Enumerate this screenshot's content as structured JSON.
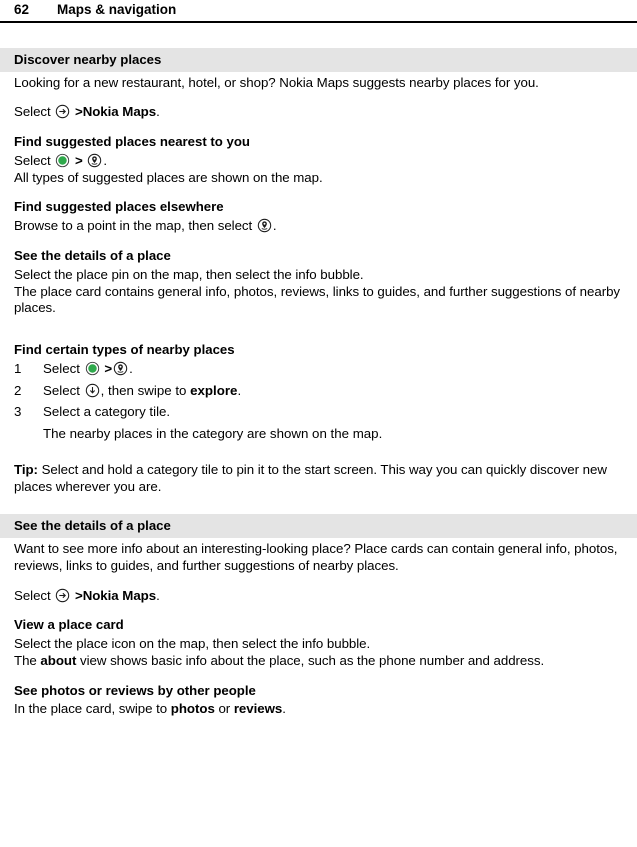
{
  "header": {
    "page_number": "62",
    "chapter": "Maps & navigation"
  },
  "icons": {
    "arrow_right_circle": "arrow-right-circle-icon",
    "green_dot_circle": "green-dot-circle-icon",
    "place_pin_circle": "place-pin-circle-icon",
    "arrow_down_circle": "arrow-down-circle-icon",
    "green_color": "#2FA94C"
  },
  "sections": [
    {
      "bar_title": "Discover nearby places",
      "intro": "Looking for a new restaurant, hotel, or shop? Nokia Maps suggests nearby places for you.",
      "select_prefix": "Select",
      "select_gt": ">",
      "select_target": "Nokia Maps",
      "select_suffix": ".",
      "blocks": [
        {
          "heading": "Find suggested places nearest to you",
          "line_prefix": "Select",
          "line_gt": ">",
          "line_suffix": ".",
          "note": "All types of suggested places are shown on the map."
        },
        {
          "heading": "Find suggested places elsewhere",
          "line_prefix": "Browse to a point in the map, then select",
          "line_suffix": "."
        },
        {
          "heading": "See the details of a place",
          "line1": "Select the place pin on the map, then select the info bubble.",
          "line2": "The place card contains general info, photos, reviews, links to guides, and further suggestions of nearby places."
        }
      ],
      "procedure": {
        "heading": "Find certain types of nearby places",
        "steps": [
          {
            "num": "1",
            "prefix": "Select",
            "gt": ">",
            "suffix": "."
          },
          {
            "num": "2",
            "prefix": "Select",
            "mid": ", then swipe to",
            "bold": "explore",
            "suffix": "."
          },
          {
            "num": "3",
            "prefix": "Select a category tile.",
            "continuation": "The nearby places in the category are shown on the map."
          }
        ]
      },
      "tip": {
        "label": "Tip:",
        "text": " Select and hold a category tile to pin it to the start screen. This way you can quickly discover new places wherever you are."
      }
    },
    {
      "bar_title": "See the details of a place",
      "intro": "Want to see more info about an interesting-looking place? Place cards can contain general info, photos, reviews, links to guides, and further suggestions of nearby places.",
      "select_prefix": "Select",
      "select_gt": ">",
      "select_target": "Nokia Maps",
      "select_suffix": ".",
      "blocks": [
        {
          "heading": "View a place card",
          "line1": "Select the place icon on the map, then select the info bubble.",
          "line2_pre": "The ",
          "line2_bold": "about",
          "line2_post": " view shows basic info about the place, such as the phone number and address."
        },
        {
          "heading": "See photos or reviews by other people",
          "line1_pre": "In the place card, swipe to ",
          "line1_b1": "photos",
          "line1_mid": " or ",
          "line1_b2": "reviews",
          "line1_post": "."
        }
      ]
    }
  ]
}
